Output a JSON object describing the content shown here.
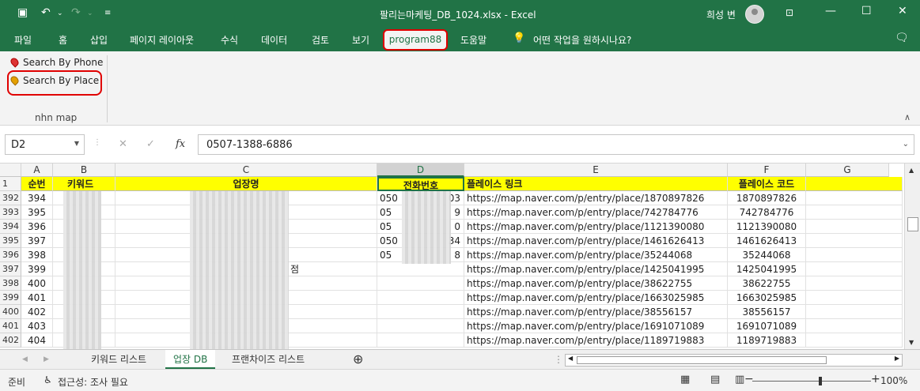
{
  "titlebar": {
    "title": "팔리는마케팅_DB_1024.xlsx  -  Excel",
    "user": "희성 변"
  },
  "menu": {
    "items": [
      "파일",
      "홈",
      "삽입",
      "페이지 레이아웃",
      "수식",
      "데이터",
      "검토",
      "보기"
    ],
    "active_tab": "program88",
    "after": [
      "도움말"
    ],
    "tellme": "어떤 작업을 원하시나요?"
  },
  "ribbon": {
    "buttons": [
      "Search By Phone",
      "Search By Place"
    ],
    "group_label": "nhn map"
  },
  "formula": {
    "namebox": "D2",
    "fx_label": "fx",
    "value": "0507-1388-6886"
  },
  "grid": {
    "columns": [
      "A",
      "B",
      "C",
      "D",
      "E",
      "F",
      "G"
    ],
    "selected_column": "D",
    "header_row_num": "1",
    "headers": [
      "순번",
      "키워드",
      "업장명",
      "전화번호",
      "플레이스 링크",
      "플레이스 코드",
      ""
    ],
    "rows": [
      {
        "num": "392",
        "seq": "394",
        "phone_start": "050",
        "phone_end": "03",
        "link": "https://map.naver.com/p/entry/place/1870897826",
        "code": "1870897826",
        "name_suffix": ""
      },
      {
        "num": "393",
        "seq": "395",
        "phone_start": "05",
        "phone_end": "9",
        "link": "https://map.naver.com/p/entry/place/742784776",
        "code": "742784776",
        "name_suffix": ""
      },
      {
        "num": "394",
        "seq": "396",
        "phone_start": "05",
        "phone_end": "0",
        "link": "https://map.naver.com/p/entry/place/1121390080",
        "code": "1121390080",
        "name_suffix": ""
      },
      {
        "num": "395",
        "seq": "397",
        "phone_start": "050",
        "phone_end": "34",
        "link": "https://map.naver.com/p/entry/place/1461626413",
        "code": "1461626413",
        "name_suffix": ""
      },
      {
        "num": "396",
        "seq": "398",
        "phone_start": "05",
        "phone_end": "8",
        "link": "https://map.naver.com/p/entry/place/35244068",
        "code": "35244068",
        "name_suffix": ""
      },
      {
        "num": "397",
        "seq": "399",
        "phone_start": "",
        "phone_end": "",
        "link": "https://map.naver.com/p/entry/place/1425041995",
        "code": "1425041995",
        "name_suffix": "점"
      },
      {
        "num": "398",
        "seq": "400",
        "phone_start": "",
        "phone_end": "",
        "link": "https://map.naver.com/p/entry/place/38622755",
        "code": "38622755",
        "name_suffix": ""
      },
      {
        "num": "399",
        "seq": "401",
        "phone_start": "",
        "phone_end": "",
        "link": "https://map.naver.com/p/entry/place/1663025985",
        "code": "1663025985",
        "name_suffix": ""
      },
      {
        "num": "400",
        "seq": "402",
        "phone_start": "",
        "phone_end": "",
        "link": "https://map.naver.com/p/entry/place/38556157",
        "code": "38556157",
        "name_suffix": ""
      },
      {
        "num": "401",
        "seq": "403",
        "phone_start": "",
        "phone_end": "",
        "link": "https://map.naver.com/p/entry/place/1691071089",
        "code": "1691071089",
        "name_suffix": ""
      },
      {
        "num": "402",
        "seq": "404",
        "phone_start": "",
        "phone_end": "",
        "link": "https://map.naver.com/p/entry/place/1189719883",
        "code": "1189719883",
        "name_suffix": ""
      }
    ]
  },
  "sheets": {
    "tabs": [
      "키워드 리스트",
      "업장 DB",
      "프랜차이즈 리스트"
    ],
    "active": "업장 DB"
  },
  "status": {
    "ready": "준비",
    "accessibility": "접근성: 조사 필요",
    "zoom": "100%"
  }
}
